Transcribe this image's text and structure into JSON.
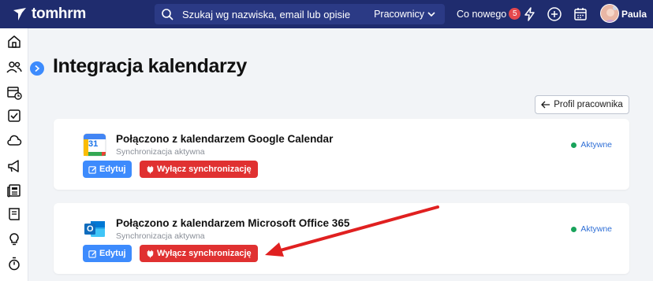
{
  "app": {
    "name": "tomhrm"
  },
  "topbar": {
    "search_placeholder": "Szukaj wg nazwiska, email lub opisie",
    "search_filter": "Pracownicy",
    "news_label": "Co nowego",
    "news_count": "5",
    "user_name": "Paula",
    "icons": [
      "search-icon",
      "chevron-down-icon",
      "lightning-icon",
      "plus-circle-icon",
      "calendar-icon"
    ]
  },
  "sidebar": {
    "icons": [
      "home-icon",
      "users-icon",
      "calendar-clock-icon",
      "checkbox-icon",
      "cloud-icon",
      "megaphone-icon",
      "newspaper-icon",
      "book-icon",
      "lightbulb-icon",
      "stopwatch-icon"
    ]
  },
  "page": {
    "title": "Integracja kalendarzy",
    "profile_button": "Profil pracownika"
  },
  "integrations": [
    {
      "title": "Połączono z kalendarzem Google Calendar",
      "subtitle": "Synchronizacja aktywna",
      "status": "Aktywne",
      "edit_label": "Edytuj",
      "disable_label": "Wyłącz synchronizację",
      "logo_day": "31"
    },
    {
      "title": "Połączono z kalendarzem Microsoft Office 365",
      "subtitle": "Synchronizacja aktywna",
      "status": "Aktywne",
      "edit_label": "Edytuj",
      "disable_label": "Wyłącz synchronizację",
      "logo_letter": "O"
    }
  ],
  "colors": {
    "topbar": "#1f2c6e",
    "primary": "#3d8bfd",
    "danger": "#e03131",
    "status_active": "#19a35b",
    "annotation_arrow": "#e02020"
  }
}
